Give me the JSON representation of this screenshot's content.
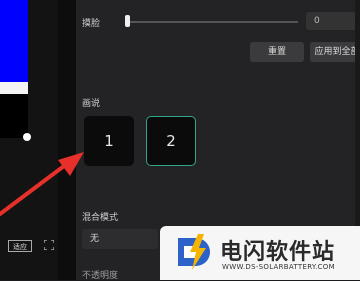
{
  "controls": {
    "slider_label": "摸脸",
    "slider_value": "0",
    "slider_fraction": 0.02,
    "reset_button": "重置",
    "apply_button": "应用到全部"
  },
  "frames": {
    "section_label": "画说",
    "items": [
      {
        "label": "1"
      },
      {
        "label": "2"
      }
    ]
  },
  "blend": {
    "label": "混合模式",
    "value": "无",
    "next_label": "不透明度"
  },
  "preview_controls": {
    "zoom_label": "适应"
  },
  "watermark": {
    "title": "电闪软件站",
    "url": "WWW.DS-SOLARBATTERY.COM"
  },
  "colors": {
    "accent": "#2fa58a",
    "arrow": "#e8302a",
    "preview_bg": "#0000ff"
  }
}
